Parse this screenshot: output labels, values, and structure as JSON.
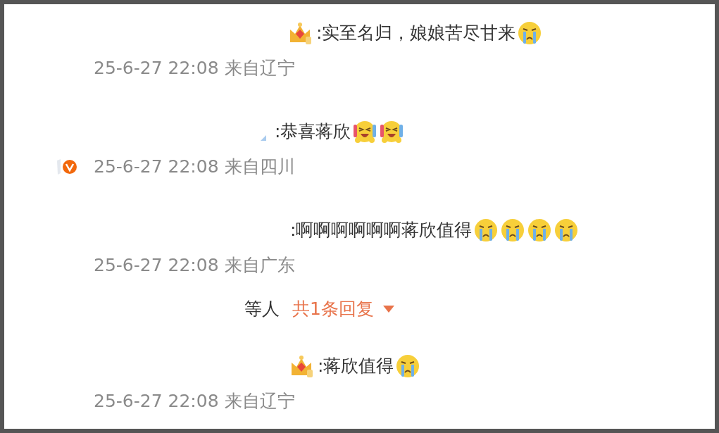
{
  "comments": [
    {
      "badge": {
        "kind": "crown"
      },
      "text": ":实至名归，娘娘苦尽甘来",
      "emojis": [
        {
          "kind": "crying"
        }
      ],
      "verified": false,
      "meta": "25-6-27 22:08 来自辽宁"
    },
    {
      "badge": {
        "kind": "fragment"
      },
      "text": ":恭喜蒋欣",
      "emojis": [
        {
          "kind": "laughing"
        },
        {
          "kind": "laughing"
        }
      ],
      "verified": true,
      "meta": "25-6-27 22:08 来自四川"
    },
    {
      "text": ":啊啊啊啊啊啊蒋欣值得",
      "emojis": [
        {
          "kind": "crying"
        },
        {
          "kind": "crying"
        },
        {
          "kind": "crying"
        },
        {
          "kind": "crying"
        }
      ],
      "verified": false,
      "meta": "25-6-27 22:08 来自广东",
      "replies": {
        "prefix": "等人",
        "link": "共1条回复",
        "expanded": false
      }
    },
    {
      "badge": {
        "kind": "crown"
      },
      "text": ":蒋欣值得",
      "emojis": [
        {
          "kind": "crying"
        }
      ],
      "verified": false,
      "meta": "25-6-27 22:08 来自辽宁"
    }
  ]
}
